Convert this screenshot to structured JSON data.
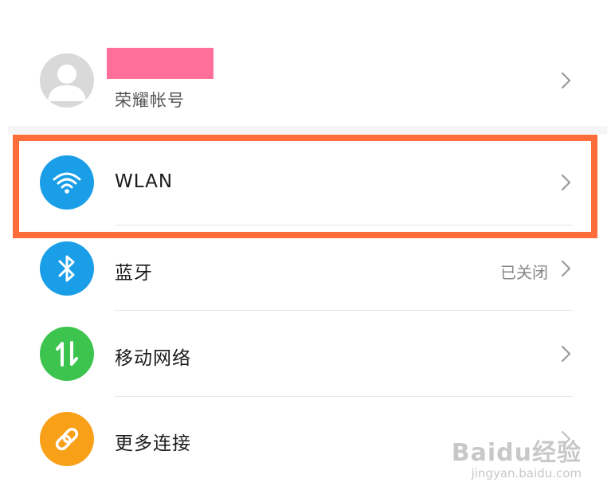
{
  "account": {
    "label": "荣耀帐号",
    "redaction_color": "#ff6f9a"
  },
  "settings": [
    {
      "id": "wlan",
      "label": "WLAN",
      "status": "",
      "icon": "wifi-icon",
      "color": "#1a9ee8"
    },
    {
      "id": "bluetooth",
      "label": "蓝牙",
      "status": "已关闭",
      "icon": "bluetooth-icon",
      "color": "#1a9ee8"
    },
    {
      "id": "mobile-network",
      "label": "移动网络",
      "status": "",
      "icon": "mobile-data-icon",
      "color": "#3cc44e"
    },
    {
      "id": "more-connections",
      "label": "更多连接",
      "status": "",
      "icon": "link-icon",
      "color": "#f8a017"
    }
  ],
  "highlight": {
    "target": "wlan",
    "color": "#ff6d3b"
  },
  "watermark": {
    "main": "Baidu经验",
    "sub": "jingyan.baidu.com"
  }
}
